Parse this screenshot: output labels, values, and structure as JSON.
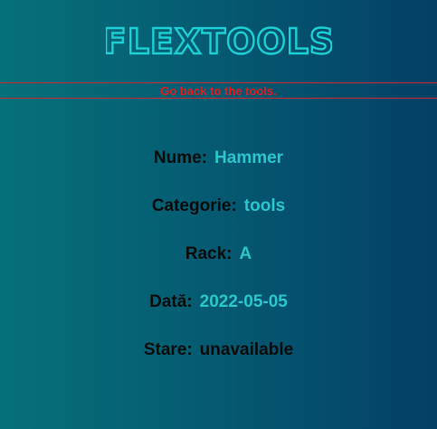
{
  "logo": {
    "text": "FLEXTOOLS",
    "color": "#1ccfd4"
  },
  "nav": {
    "back_label": "Go back to the tools."
  },
  "details": [
    {
      "label": "Nume:",
      "value": "Hammer"
    },
    {
      "label": "Categorie:",
      "value": "tools"
    },
    {
      "label": "Rack:",
      "value": "A"
    },
    {
      "label": "Dată:",
      "value": "2022-05-05"
    },
    {
      "label": "Stare:",
      "value": "unavailable"
    }
  ],
  "colors": {
    "background_left": "#06707a",
    "background_right": "#043f66",
    "accent": "#2bc6c9",
    "link": "#e11d1d"
  }
}
